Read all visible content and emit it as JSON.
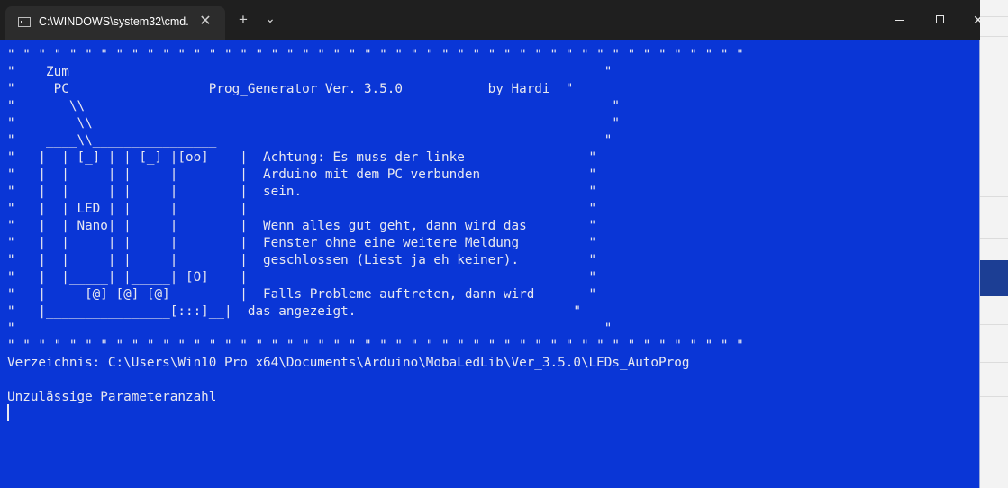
{
  "window": {
    "tab_title": "C:\\WINDOWS\\system32\\cmd.",
    "tab_close": "✕",
    "new_tab": "+",
    "dropdown": "⌄",
    "close_symbol": "✕"
  },
  "console": {
    "lines": [
      "\" \" \" \" \" \" \" \" \" \" \" \" \" \" \" \" \" \" \" \" \" \" \" \" \" \" \" \" \" \" \" \" \" \" \" \" \" \" \" \" \" \" \" \" \" \" \" \"",
      "\"    Zum                                                                     \"",
      "\"     PC                  Prog_Generator Ver. 3.5.0           by Hardi  \"",
      "\"       \\\\                                                                    \"",
      "\"        \\\\                                                                   \"",
      "\"    ____\\\\________________                                                  \"",
      "\"   |  | [_] | | [_] |[oo]    |  Achtung: Es muss der linke                \"",
      "\"   |  |     | |     |        |  Arduino mit dem PC verbunden              \"",
      "\"   |  |     | |     |        |  sein.                                     \"",
      "\"   |  | LED | |     |        |                                            \"",
      "\"   |  | Nano| |     |        |  Wenn alles gut geht, dann wird das        \"",
      "\"   |  |     | |     |        |  Fenster ohne eine weitere Meldung         \"",
      "\"   |  |     | |     |        |  geschlossen (Liest ja eh keiner).         \"",
      "\"   |  |_____| |_____| [O]    |                                            \"",
      "\"   |     [@] [@] [@]         |  Falls Probleme auftreten, dann wird       \"",
      "\"   |________________[:::]__|  das angezeigt.                            \"",
      "\"                                                                            \"",
      "\" \" \" \" \" \" \" \" \" \" \" \" \" \" \" \" \" \" \" \" \" \" \" \" \" \" \" \" \" \" \" \" \" \" \" \" \" \" \" \" \" \" \" \" \" \" \" \"",
      "Verzeichnis: C:\\Users\\Win10 Pro x64\\Documents\\Arduino\\MobaLedLib\\Ver_3.5.0\\LEDs_AutoProg",
      "",
      "Unzulässige Parameteranzahl"
    ]
  },
  "colors": {
    "console_bg": "#0a36d6",
    "console_fg": "#e8e8f0",
    "titlebar_bg": "#1f1f1f"
  },
  "icons": [
    "cmd-icon",
    "close-icon",
    "plus-icon",
    "chevron-down-icon",
    "minimize-icon",
    "maximize-icon"
  ]
}
